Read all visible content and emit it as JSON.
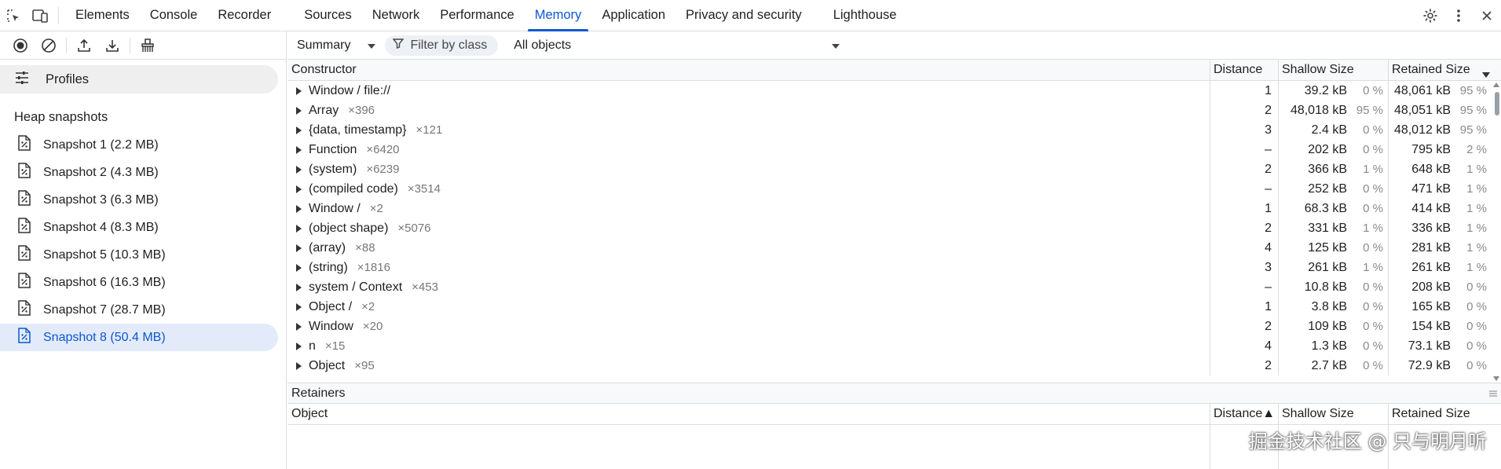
{
  "tabs": [
    {
      "label": "Elements",
      "active": false
    },
    {
      "label": "Console",
      "active": false
    },
    {
      "label": "Recorder",
      "active": false
    },
    {
      "label": "Sources",
      "active": false
    },
    {
      "label": "Network",
      "active": false
    },
    {
      "label": "Performance",
      "active": false
    },
    {
      "label": "Memory",
      "active": true
    },
    {
      "label": "Application",
      "active": false
    },
    {
      "label": "Privacy and security",
      "active": false
    },
    {
      "label": "Lighthouse",
      "active": false
    }
  ],
  "sidebar": {
    "profiles_label": "Profiles",
    "heap_snapshots_label": "Heap snapshots",
    "snapshots": [
      {
        "label": "Snapshot 1 (2.2 MB)",
        "selected": false
      },
      {
        "label": "Snapshot 2 (4.3 MB)",
        "selected": false
      },
      {
        "label": "Snapshot 3 (6.3 MB)",
        "selected": false
      },
      {
        "label": "Snapshot 4 (8.3 MB)",
        "selected": false
      },
      {
        "label": "Snapshot 5 (10.3 MB)",
        "selected": false
      },
      {
        "label": "Snapshot 6 (16.3 MB)",
        "selected": false
      },
      {
        "label": "Snapshot 7 (28.7 MB)",
        "selected": false
      },
      {
        "label": "Snapshot 8 (50.4 MB)",
        "selected": true
      }
    ]
  },
  "toolbar": {
    "view_select": "Summary",
    "filter_label": "Filter by class",
    "objects_select": "All objects"
  },
  "table": {
    "columns": [
      "Constructor",
      "Distance",
      "Shallow Size",
      "Retained Size"
    ],
    "rows": [
      {
        "name": "Window / file://",
        "count": "",
        "distance": "1",
        "shallow": "39.2 kB",
        "shallow_pct": "0 %",
        "retained": "48,061 kB",
        "retained_pct": "95 %"
      },
      {
        "name": "Array",
        "count": "×396",
        "distance": "2",
        "shallow": "48,018 kB",
        "shallow_pct": "95 %",
        "retained": "48,051 kB",
        "retained_pct": "95 %"
      },
      {
        "name": "{data, timestamp}",
        "count": "×121",
        "distance": "3",
        "shallow": "2.4 kB",
        "shallow_pct": "0 %",
        "retained": "48,012 kB",
        "retained_pct": "95 %"
      },
      {
        "name": "Function",
        "count": "×6420",
        "distance": "–",
        "shallow": "202 kB",
        "shallow_pct": "0 %",
        "retained": "795 kB",
        "retained_pct": "2 %"
      },
      {
        "name": "(system)",
        "count": "×6239",
        "distance": "2",
        "shallow": "366 kB",
        "shallow_pct": "1 %",
        "retained": "648 kB",
        "retained_pct": "1 %"
      },
      {
        "name": "(compiled code)",
        "count": "×3514",
        "distance": "–",
        "shallow": "252 kB",
        "shallow_pct": "0 %",
        "retained": "471 kB",
        "retained_pct": "1 %"
      },
      {
        "name": "Window /",
        "count": "×2",
        "distance": "1",
        "shallow": "68.3 kB",
        "shallow_pct": "0 %",
        "retained": "414 kB",
        "retained_pct": "1 %"
      },
      {
        "name": "(object shape)",
        "count": "×5076",
        "distance": "2",
        "shallow": "331 kB",
        "shallow_pct": "1 %",
        "retained": "336 kB",
        "retained_pct": "1 %"
      },
      {
        "name": "(array)",
        "count": "×88",
        "distance": "4",
        "shallow": "125 kB",
        "shallow_pct": "0 %",
        "retained": "281 kB",
        "retained_pct": "1 %"
      },
      {
        "name": "(string)",
        "count": "×1816",
        "distance": "3",
        "shallow": "261 kB",
        "shallow_pct": "1 %",
        "retained": "261 kB",
        "retained_pct": "1 %"
      },
      {
        "name": "system / Context",
        "count": "×453",
        "distance": "–",
        "shallow": "10.8 kB",
        "shallow_pct": "0 %",
        "retained": "208 kB",
        "retained_pct": "0 %"
      },
      {
        "name": "Object /",
        "count": "×2",
        "distance": "1",
        "shallow": "3.8 kB",
        "shallow_pct": "0 %",
        "retained": "165 kB",
        "retained_pct": "0 %"
      },
      {
        "name": "Window",
        "count": "×20",
        "distance": "2",
        "shallow": "109 kB",
        "shallow_pct": "0 %",
        "retained": "154 kB",
        "retained_pct": "0 %"
      },
      {
        "name": "n",
        "count": "×15",
        "distance": "4",
        "shallow": "1.3 kB",
        "shallow_pct": "0 %",
        "retained": "73.1 kB",
        "retained_pct": "0 %"
      },
      {
        "name": "Object",
        "count": "×95",
        "distance": "2",
        "shallow": "2.7 kB",
        "shallow_pct": "0 %",
        "retained": "72.9 kB",
        "retained_pct": "0 %"
      }
    ]
  },
  "retainers": {
    "title": "Retainers",
    "columns": [
      "Object",
      "Distance▲",
      "Shallow Size",
      "Retained Size"
    ]
  },
  "watermark": "掘金技术社区 @ 只与明月听",
  "colors": {
    "accent": "#0b57d0",
    "selected_bg": "#e3ebfb"
  }
}
